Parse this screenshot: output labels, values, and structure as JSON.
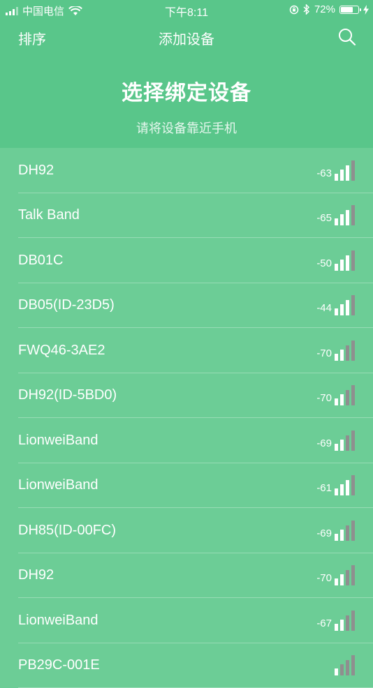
{
  "status_bar": {
    "carrier": "中国电信",
    "time": "下午8:11",
    "battery_percent": "72%",
    "battery_level": 0.72,
    "cell_signal_bars_on": 3,
    "icons": [
      "cellular-signal-icon",
      "wifi-icon",
      "orientation-lock-icon",
      "bluetooth-icon",
      "battery-icon",
      "charging-icon"
    ]
  },
  "nav": {
    "sort_label": "排序",
    "title": "添加设备",
    "search_icon": "search-icon"
  },
  "hero": {
    "title": "选择绑定设备",
    "subtitle": "请将设备靠近手机"
  },
  "colors": {
    "header_bg": "#59c68a",
    "list_bg": "#6ccd96",
    "bar_on": "#ffffff",
    "bar_off": "#8f8f8f"
  },
  "devices": [
    {
      "name": "DH92",
      "rssi": "-63",
      "bars_on": 3
    },
    {
      "name": "Talk Band",
      "rssi": "-65",
      "bars_on": 3
    },
    {
      "name": "DB01C",
      "rssi": "-50",
      "bars_on": 3
    },
    {
      "name": "DB05(ID-23D5)",
      "rssi": "-44",
      "bars_on": 3
    },
    {
      "name": "FWQ46-3AE2",
      "rssi": "-70",
      "bars_on": 2
    },
    {
      "name": "DH92(ID-5BD0)",
      "rssi": "-70",
      "bars_on": 2
    },
    {
      "name": "LionweiBand",
      "rssi": "-69",
      "bars_on": 2
    },
    {
      "name": "LionweiBand",
      "rssi": "-61",
      "bars_on": 3
    },
    {
      "name": "DH85(ID-00FC)",
      "rssi": "-69",
      "bars_on": 2
    },
    {
      "name": "DH92",
      "rssi": "-70",
      "bars_on": 2
    },
    {
      "name": "LionweiBand",
      "rssi": "-67",
      "bars_on": 2
    },
    {
      "name": "PB29C-001E",
      "rssi": "",
      "bars_on": 1
    }
  ]
}
